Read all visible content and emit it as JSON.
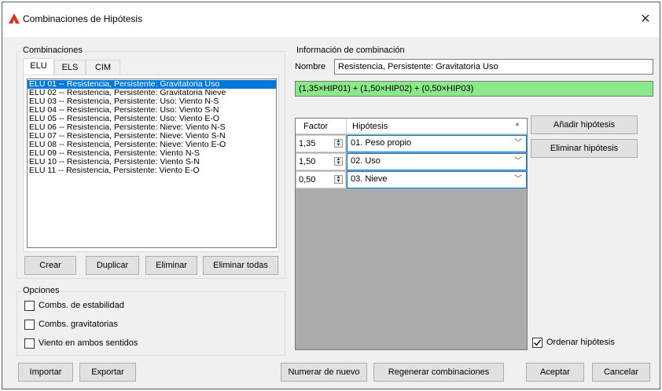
{
  "window": {
    "title": "Combinaciones de Hipótesis",
    "close_glyph": "✕",
    "icon": "app-logo-icon",
    "icon_color": "#d9351c"
  },
  "combinaciones": {
    "label": "Combinaciones",
    "tabs": [
      {
        "label": "ELU",
        "active": true
      },
      {
        "label": "ELS",
        "active": false
      },
      {
        "label": "CIM",
        "active": false
      }
    ],
    "items": [
      "ELU 01 -- Resistencia, Persistente: Gravitatoria Uso",
      "ELU 02 -- Resistencia, Persistente: Gravitatoria Nieve",
      "ELU 03 -- Resistencia, Persistente: Uso: Viento N-S",
      "ELU 04 -- Resistencia, Persistente: Uso: Viento S-N",
      "ELU 05 -- Resistencia, Persistente: Uso: Viento E-O",
      "ELU 06 -- Resistencia, Persistente: Nieve: Viento N-S",
      "ELU 07 -- Resistencia, Persistente: Nieve: Viento S-N",
      "ELU 08 -- Resistencia, Persistente: Nieve: Viento E-O",
      "ELU 09 -- Resistencia, Persistente: Viento N-S",
      "ELU 10 -- Resistencia, Persistente: Viento S-N",
      "ELU 11 -- Resistencia, Persistente: Viento E-O"
    ],
    "selected_index": 0,
    "buttons": {
      "crear": "Crear",
      "duplicar": "Duplicar",
      "eliminar": "Eliminar",
      "eliminar_todas": "Eliminar todas"
    }
  },
  "opciones": {
    "label": "Opciones",
    "checks": [
      {
        "label": "Combs. de estabilidad",
        "checked": false
      },
      {
        "label": "Combs. gravitatorias",
        "checked": false
      },
      {
        "label": "Viento en ambos sentidos",
        "checked": false
      }
    ]
  },
  "info": {
    "label": "Información de combinación",
    "nombre_label": "Nombre",
    "nombre_value": "Resistencia, Persistente: Gravitatoria Uso",
    "formula": "(1,35×HIP01) + (1,50×HIP02) + (0,50×HIP03)",
    "formula_bg": "#8be88b",
    "grid": {
      "col_factor": "Factor",
      "col_hipotesis": "Hipótesis",
      "rows": [
        {
          "factor": "1,35",
          "hipotesis": "01. Peso propio"
        },
        {
          "factor": "1,50",
          "hipotesis": "02. Uso"
        },
        {
          "factor": "0,50",
          "hipotesis": "03. Nieve"
        }
      ]
    },
    "anadir": "Añadir hipótesis",
    "eliminar": "Eliminar hipótesis",
    "ordenar": {
      "label": "Ordenar hipótesis",
      "checked": true
    }
  },
  "footer": {
    "importar": "Importar",
    "exportar": "Exportar",
    "numerar": "Numerar de nuevo",
    "regenerar": "Regenerar combinaciones",
    "aceptar": "Aceptar",
    "cancelar": "Cancelar"
  }
}
